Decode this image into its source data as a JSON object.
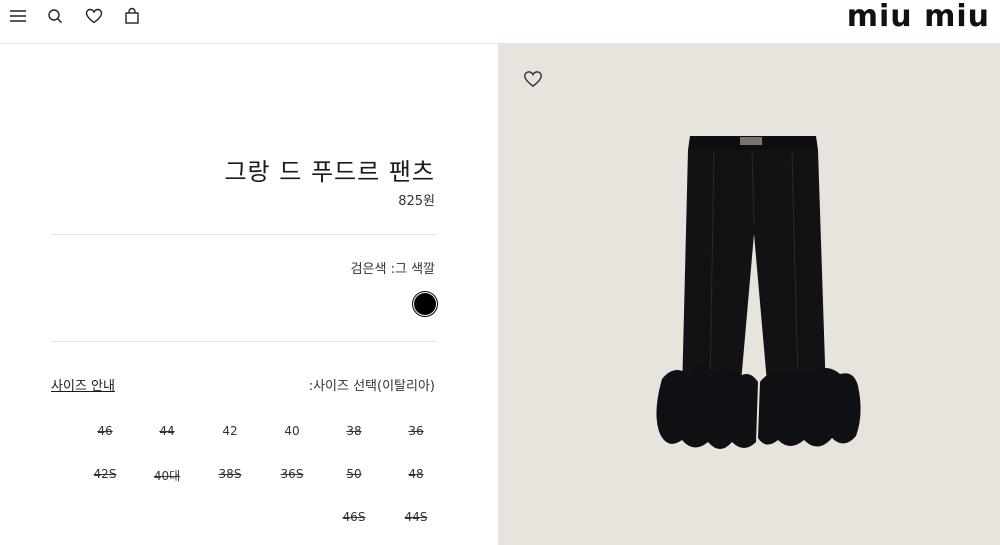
{
  "header": {
    "icons": [
      "menu-icon",
      "search-icon",
      "heart-icon",
      "bag-icon"
    ],
    "logo_text": "miu miu"
  },
  "product": {
    "title": "그랑 드 푸드르 팬츠",
    "price": "825원",
    "color_label": "검은색 :그 색깔",
    "swatch_color": "#000000",
    "size_guide": "사이즈 안내",
    "size_select_label": ":사이즈 선택(이탈리아)",
    "sizes": [
      {
        "label": "46",
        "available": false
      },
      {
        "label": "44",
        "available": false
      },
      {
        "label": "42",
        "available": true
      },
      {
        "label": "40",
        "available": true
      },
      {
        "label": "38",
        "available": false
      },
      {
        "label": "36",
        "available": false
      },
      {
        "label": "42S",
        "available": false
      },
      {
        "label": "40대",
        "available": false
      },
      {
        "label": "38S",
        "available": false
      },
      {
        "label": "36S",
        "available": false
      },
      {
        "label": "50",
        "available": false
      },
      {
        "label": "48",
        "available": false
      },
      {
        "label": "46S",
        "available": false
      },
      {
        "label": "44S",
        "available": false
      }
    ]
  },
  "colors": {
    "image_background": "#e8e4dd",
    "divider": "#e3e3e3"
  }
}
